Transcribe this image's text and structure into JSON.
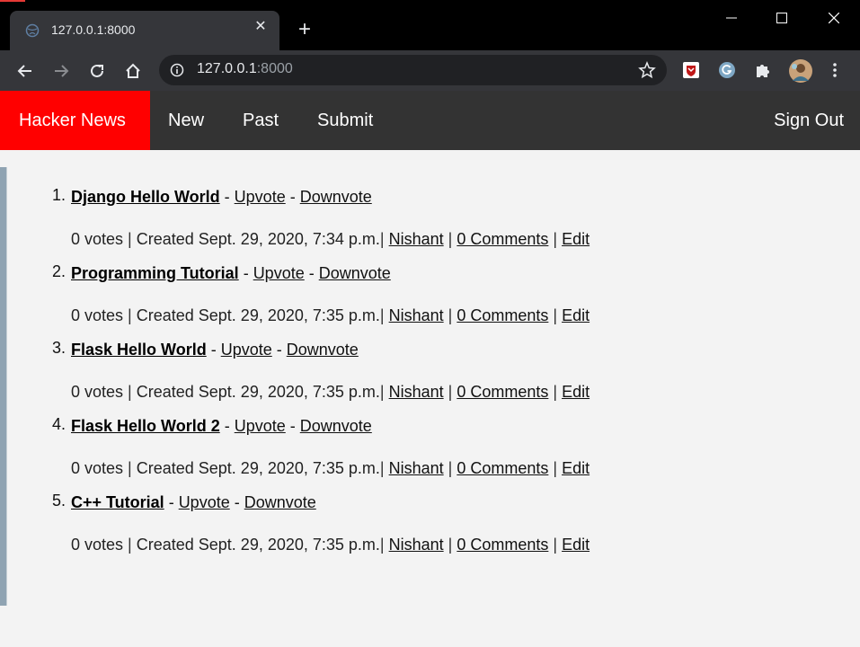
{
  "browser": {
    "tab_title": "127.0.0.1:8000",
    "url_host": "127.0.0.1",
    "url_port": ":8000"
  },
  "navbar": {
    "brand": "Hacker News",
    "new": "New",
    "past": "Past",
    "submit": "Submit",
    "sign_out": "Sign Out"
  },
  "posts": [
    {
      "index": "1.",
      "title": "Django Hello World",
      "upvote": "Upvote",
      "downvote": "Downvote",
      "votes": "0 votes",
      "created": "Created Sept. 29, 2020, 7:34 p.m.",
      "author": "Nishant",
      "comments": "0 Comments",
      "edit": "Edit"
    },
    {
      "index": "2.",
      "title": "Programming Tutorial",
      "upvote": "Upvote",
      "downvote": "Downvote",
      "votes": "0 votes",
      "created": "Created Sept. 29, 2020, 7:35 p.m.",
      "author": "Nishant",
      "comments": "0 Comments",
      "edit": "Edit"
    },
    {
      "index": "3.",
      "title": "Flask Hello World",
      "upvote": "Upvote",
      "downvote": "Downvote",
      "votes": "0 votes",
      "created": "Created Sept. 29, 2020, 7:35 p.m.",
      "author": "Nishant",
      "comments": "0 Comments",
      "edit": "Edit"
    },
    {
      "index": "4.",
      "title": "Flask Hello World 2",
      "upvote": "Upvote",
      "downvote": "Downvote",
      "votes": "0 votes",
      "created": "Created Sept. 29, 2020, 7:35 p.m.",
      "author": "Nishant",
      "comments": "0 Comments",
      "edit": "Edit"
    },
    {
      "index": "5.",
      "title": "C++ Tutorial",
      "upvote": "Upvote",
      "downvote": "Downvote",
      "votes": "0 votes",
      "created": "Created Sept. 29, 2020, 7:35 p.m.",
      "author": "Nishant",
      "comments": "0 Comments",
      "edit": "Edit"
    }
  ],
  "colors": {
    "brand_bg": "#ff0000",
    "navbar_bg": "#333333",
    "page_bg": "#f3f3f3"
  },
  "icons": {
    "tab_favicon": "globe-icon",
    "tab_close": "close-icon",
    "new_tab": "plus-icon",
    "back": "back-arrow-icon",
    "forward": "forward-arrow-icon",
    "reload": "reload-icon",
    "home": "home-icon",
    "site_info": "info-icon",
    "bookmark": "star-icon",
    "extension_1": "mcafee-icon",
    "extension_2": "grammarly-icon",
    "extensions": "puzzle-icon",
    "profile": "avatar",
    "menu": "kebab-menu-icon"
  }
}
